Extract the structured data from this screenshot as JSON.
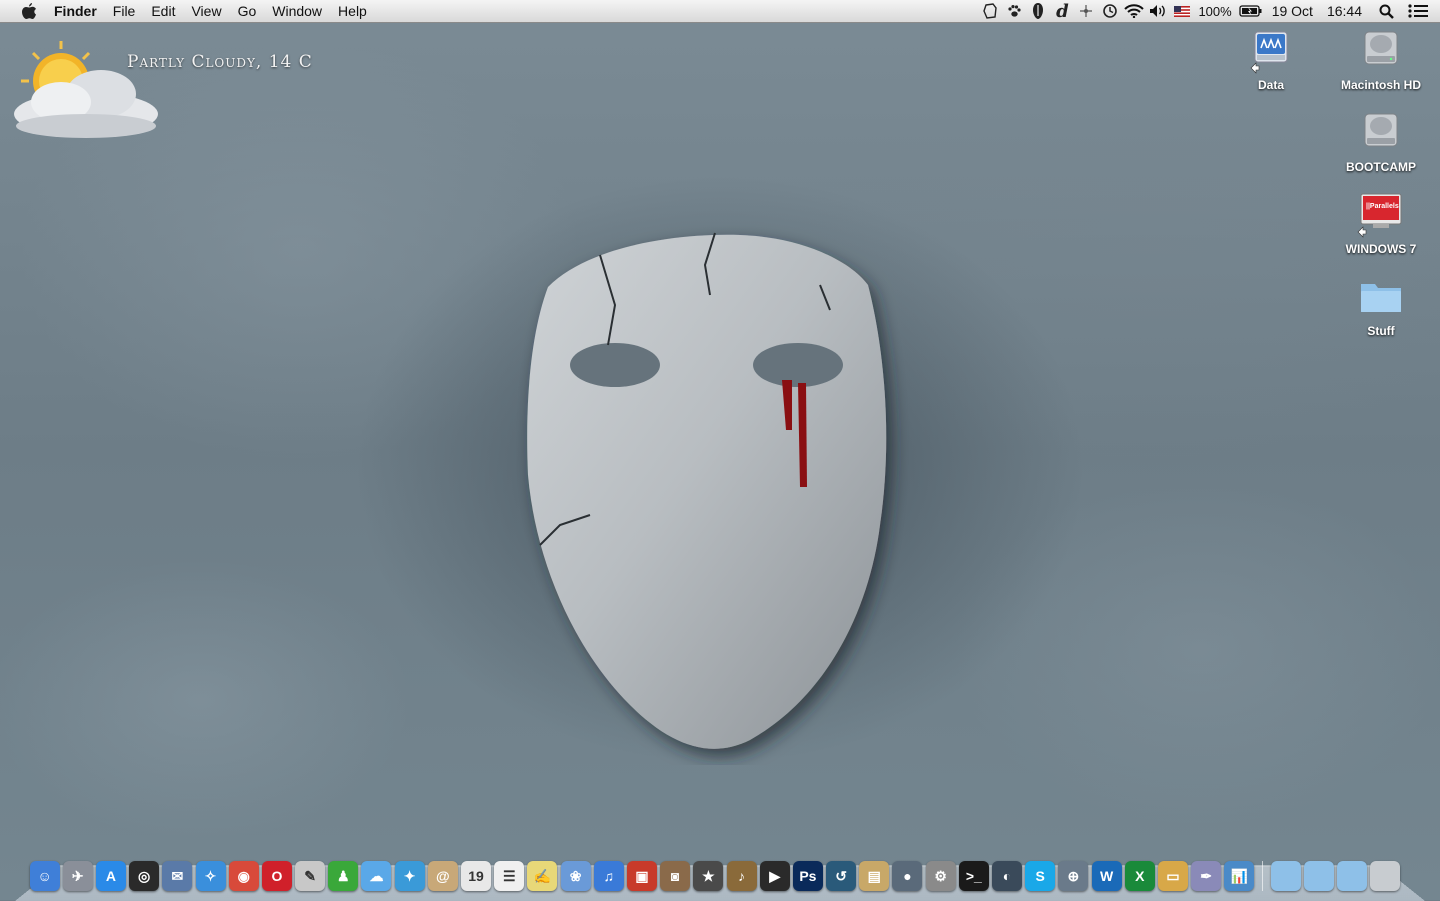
{
  "menubar": {
    "apple_icon": "apple-logo",
    "app_name": "Finder",
    "menus": [
      "File",
      "Edit",
      "View",
      "Go",
      "Window",
      "Help"
    ],
    "battery": "100%",
    "date": "19 Oct",
    "time": "16:44",
    "status_icons": [
      "evernote-icon",
      "paw-icon",
      "stylus-icon",
      "dictionary-icon",
      "move-icon",
      "time-machine-icon",
      "wifi-icon",
      "volume-icon",
      "us-flag-icon"
    ]
  },
  "weather": {
    "text": "Partly Cloudy, 14 C",
    "icon": "partly-cloudy-icon"
  },
  "desktop_icons": [
    {
      "label": "Data",
      "icon": "network-drive-icon"
    },
    {
      "label": "Macintosh HD",
      "icon": "hard-drive-icon"
    },
    {
      "label": "BOOTCAMP",
      "icon": "hard-drive-icon"
    },
    {
      "label": "WINDOWS 7",
      "icon": "parallels-icon",
      "badge": "||Parallels"
    },
    {
      "label": "Stuff",
      "icon": "folder-icon"
    }
  ],
  "dock": {
    "calendar_day": "19",
    "apps": [
      {
        "name": "finder",
        "glyph": "☺",
        "color": "#3f7fd8"
      },
      {
        "name": "launchpad",
        "glyph": "✈",
        "color": "#8a8f99"
      },
      {
        "name": "app-store",
        "glyph": "A",
        "color": "#2a8ae8"
      },
      {
        "name": "dashboard",
        "glyph": "◎",
        "color": "#2a2a2a"
      },
      {
        "name": "preview",
        "glyph": "✉",
        "color": "#5a7aa8"
      },
      {
        "name": "safari",
        "glyph": "✧",
        "color": "#3a8fdc"
      },
      {
        "name": "chrome",
        "glyph": "◉",
        "color": "#d84a3a"
      },
      {
        "name": "opera",
        "glyph": "O",
        "color": "#d0202a"
      },
      {
        "name": "pencil",
        "glyph": "✎",
        "color": "#c8c8c8"
      },
      {
        "name": "bottle",
        "glyph": "♟",
        "color": "#3aa83a"
      },
      {
        "name": "messages",
        "glyph": "☁",
        "color": "#5aa8e8"
      },
      {
        "name": "twitter",
        "glyph": "✦",
        "color": "#3a9ad8"
      },
      {
        "name": "contacts",
        "glyph": "@",
        "color": "#c8a878"
      },
      {
        "name": "calendar",
        "glyph": "19",
        "color": "#e8e8e8"
      },
      {
        "name": "reminders",
        "glyph": "☰",
        "color": "#f0f0f0"
      },
      {
        "name": "notes",
        "glyph": "✍",
        "color": "#e8d878"
      },
      {
        "name": "iphoto",
        "glyph": "❀",
        "color": "#6a9ad8"
      },
      {
        "name": "itunes",
        "glyph": "♫",
        "color": "#3a7ad8"
      },
      {
        "name": "photo-booth",
        "glyph": "▣",
        "color": "#c83a2a"
      },
      {
        "name": "image-capture",
        "glyph": "◙",
        "color": "#8a6a4a"
      },
      {
        "name": "imovie",
        "glyph": "★",
        "color": "#4a4a4a"
      },
      {
        "name": "garageband",
        "glyph": "♪",
        "color": "#8a6a3a"
      },
      {
        "name": "quicktime",
        "glyph": "▶",
        "color": "#2a2a2a"
      },
      {
        "name": "photoshop",
        "glyph": "Ps",
        "color": "#0a2a5a"
      },
      {
        "name": "time-machine",
        "glyph": "↺",
        "color": "#2a5a7a"
      },
      {
        "name": "archive",
        "glyph": "▤",
        "color": "#c8a868"
      },
      {
        "name": "facetime",
        "glyph": "●",
        "color": "#5a6a7a"
      },
      {
        "name": "system-preferences",
        "glyph": "⚙",
        "color": "#8a8a8a"
      },
      {
        "name": "terminal",
        "glyph": ">_",
        "color": "#1a1a1a"
      },
      {
        "name": "steam",
        "glyph": "◐",
        "color": "#3a4a5a"
      },
      {
        "name": "skype",
        "glyph": "S",
        "color": "#1aa8e8"
      },
      {
        "name": "network-utility",
        "glyph": "⊕",
        "color": "#6a7a8a"
      },
      {
        "name": "word",
        "glyph": "W",
        "color": "#1a6ab8"
      },
      {
        "name": "excel",
        "glyph": "X",
        "color": "#1a8a3a"
      },
      {
        "name": "keynote",
        "glyph": "▭",
        "color": "#d8a848"
      },
      {
        "name": "script-editor",
        "glyph": "✒",
        "color": "#8a8ab8"
      },
      {
        "name": "grapher",
        "glyph": "📊",
        "color": "#4a8ac8"
      }
    ],
    "stacks": [
      {
        "name": "applications-folder"
      },
      {
        "name": "documents-folder"
      },
      {
        "name": "downloads-folder"
      },
      {
        "name": "trash"
      }
    ]
  }
}
